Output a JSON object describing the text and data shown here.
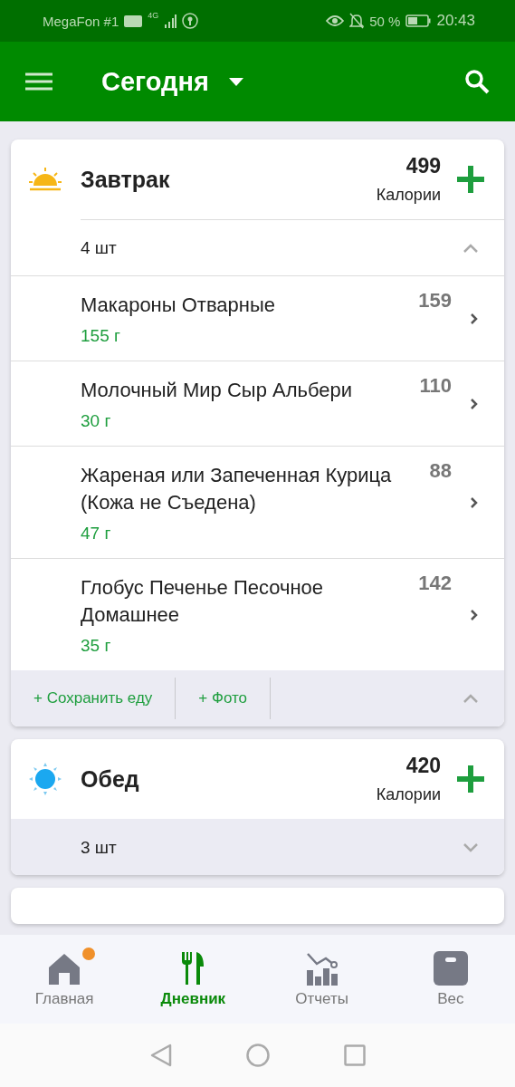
{
  "status_bar": {
    "carrier": "MegaFon #1",
    "network": "4G",
    "battery": "50 %",
    "time": "20:43"
  },
  "app_bar": {
    "title": "Сегодня"
  },
  "meals": [
    {
      "kind": "breakfast",
      "name": "Завтрак",
      "calories": "499",
      "calories_label": "Калории",
      "count": "4 шт",
      "expanded": true,
      "items": [
        {
          "name": "Макароны Отварные",
          "amount": "155 г",
          "calories": "159"
        },
        {
          "name": "Молочный Мир Сыр Альбери",
          "amount": "30 г",
          "calories": "110"
        },
        {
          "name": "Жареная или Запеченная Курица (Кожа не Съедена)",
          "amount": "47 г",
          "calories": "88"
        },
        {
          "name": "Глобус Печенье Песочное Домашнее",
          "amount": "35 г",
          "calories": "142"
        }
      ],
      "actions": [
        "+ Сохранить еду",
        "+ Фото"
      ]
    },
    {
      "kind": "lunch",
      "name": "Обед",
      "calories": "420",
      "calories_label": "Калории",
      "count": "3 шт",
      "expanded": false
    },
    {
      "kind": "partial"
    }
  ],
  "bottom_nav": [
    {
      "kind": "home",
      "label": "Главная",
      "selected": false,
      "badge": true
    },
    {
      "kind": "diary",
      "label": "Дневник",
      "selected": true,
      "badge": false
    },
    {
      "kind": "reports",
      "label": "Отчеты",
      "selected": false,
      "badge": false
    },
    {
      "kind": "weight",
      "label": "Вес",
      "selected": false,
      "badge": false
    }
  ]
}
